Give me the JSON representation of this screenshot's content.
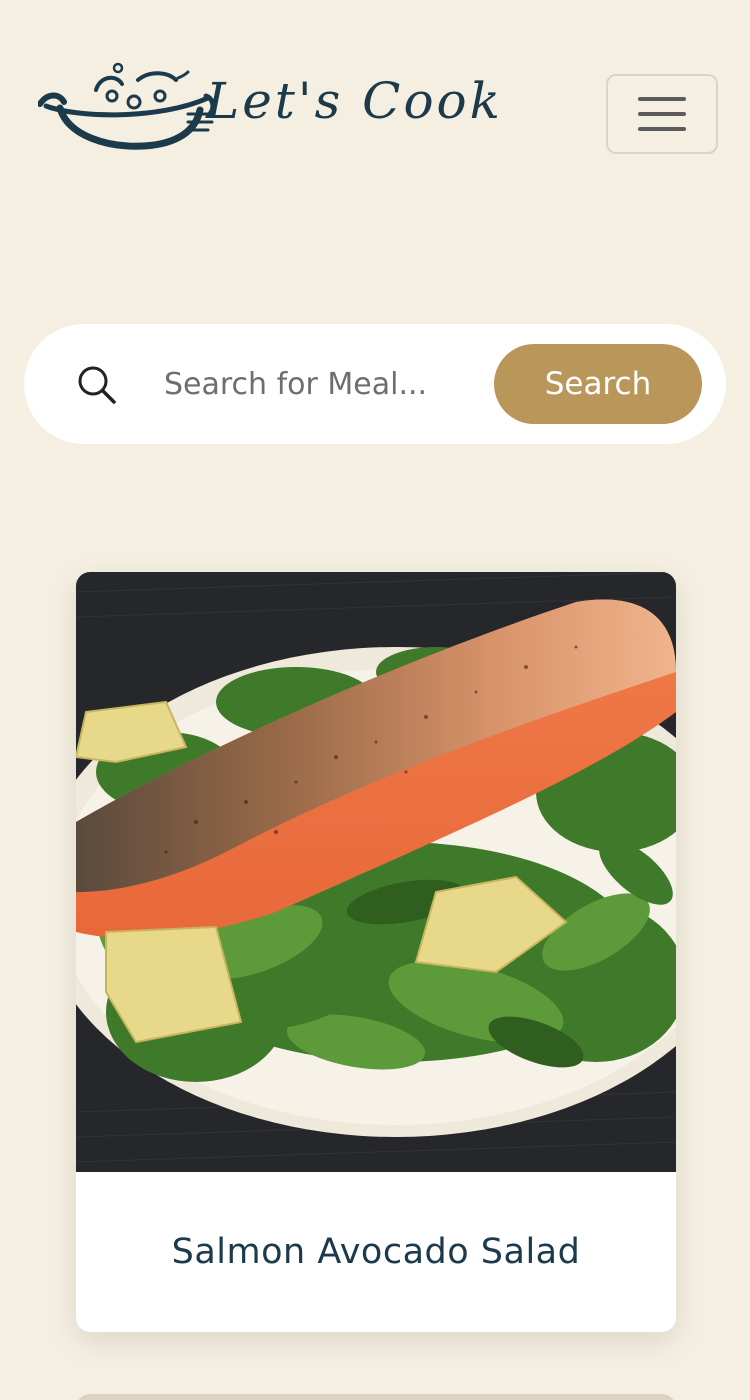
{
  "header": {
    "logo_text": "Let's  Cook",
    "menu_icon": "hamburger-menu-icon"
  },
  "search": {
    "placeholder": "Search for Meal...",
    "value": "",
    "button_label": "Search",
    "icon": "search-icon",
    "accent_color": "#b9975b"
  },
  "meals": [
    {
      "title": "Salmon Avocado Salad"
    }
  ],
  "colors": {
    "background": "#f5efe1",
    "brand": "#1b3a4b",
    "accent": "#b9975b"
  }
}
